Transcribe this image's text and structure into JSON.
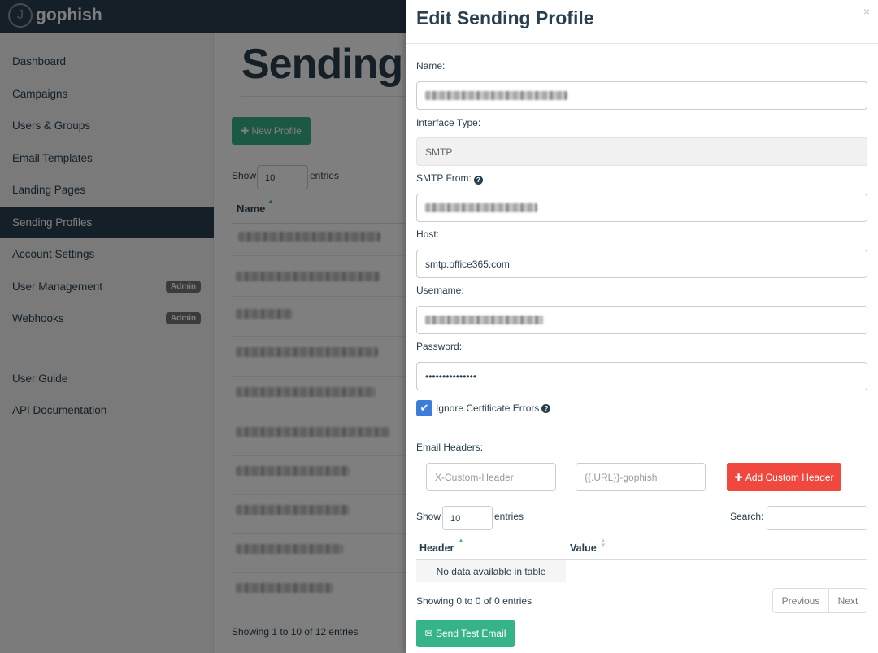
{
  "app": {
    "name": "gophish",
    "logo_glyph": "J"
  },
  "sidebar": {
    "items": [
      {
        "label": "Dashboard"
      },
      {
        "label": "Campaigns"
      },
      {
        "label": "Users & Groups"
      },
      {
        "label": "Email Templates"
      },
      {
        "label": "Landing Pages"
      },
      {
        "label": "Sending Profiles",
        "active": true
      },
      {
        "label": "Account Settings"
      },
      {
        "label": "User Management",
        "badge": "Admin"
      },
      {
        "label": "Webhooks",
        "badge": "Admin"
      }
    ],
    "footer_items": [
      {
        "label": "User Guide"
      },
      {
        "label": "API Documentation"
      }
    ]
  },
  "main": {
    "title": "Sending",
    "new_button": "New Profile",
    "show_label": "Show",
    "entries_label": "entries",
    "page_size": "10",
    "name_header": "Name",
    "footer_info": "Showing 1 to 10 of 12 entries"
  },
  "modal": {
    "title": "Edit Sending Profile",
    "close": "×",
    "name_label": "Name:",
    "interface_label": "Interface Type:",
    "interface_value": "SMTP",
    "smtp_from_label": "SMTP From:",
    "host_label": "Host:",
    "host_value": "smtp.office365.com",
    "username_label": "Username:",
    "password_label": "Password:",
    "password_value": "•••••••••••••••",
    "ignore_cert_label": "Ignore Certificate Errors",
    "ignore_cert_checked": true,
    "headers_label": "Email Headers:",
    "header_placeholder": "X-Custom-Header",
    "value_placeholder": "{{.URL}}-gophish",
    "add_header_button": "Add Custom Header",
    "show_label": "Show",
    "entries_label": "entries",
    "page_size": "10",
    "search_label": "Search:",
    "table_headers": [
      "Header",
      "Value"
    ],
    "empty_text": "No data available in table",
    "info_text": "Showing 0 to 0 of 0 entries",
    "prev_button": "Previous",
    "next_button": "Next",
    "test_button": "Send Test Email"
  },
  "colors": {
    "navy": "#283f50",
    "green": "#37b38a",
    "red": "#f0483e",
    "blue": "#3b7dd8"
  }
}
